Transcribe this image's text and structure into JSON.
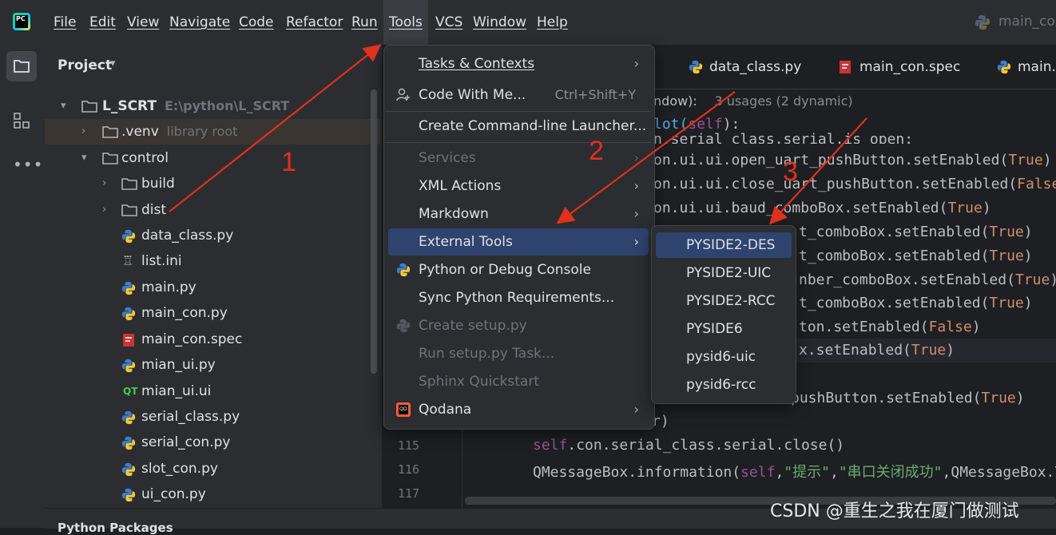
{
  "app": {
    "logo_text": "PC"
  },
  "menubar": {
    "items": [
      {
        "id": "file",
        "label": "File"
      },
      {
        "id": "edit",
        "label": "Edit"
      },
      {
        "id": "view",
        "label": "View"
      },
      {
        "id": "navigate",
        "label": "Navigate"
      },
      {
        "id": "code",
        "label": "Code"
      },
      {
        "id": "refactor",
        "label": "Refactor"
      },
      {
        "id": "run",
        "label": "Run"
      },
      {
        "id": "tools",
        "label": "Tools"
      },
      {
        "id": "vcs",
        "label": "VCS"
      },
      {
        "id": "window",
        "label": "Window"
      },
      {
        "id": "help",
        "label": "Help"
      }
    ],
    "right_label": "main_con"
  },
  "project": {
    "title": "Project",
    "tree": [
      {
        "name": "L_SCRT",
        "hint": "E:\\python\\L_SCRT",
        "type": "folder",
        "expanded": true
      },
      {
        "name": ".venv",
        "hint": "library root",
        "type": "folder",
        "expanded": false
      },
      {
        "name": "control",
        "hint": "",
        "type": "folder",
        "expanded": true
      },
      {
        "name": "build",
        "hint": "",
        "type": "folder",
        "expanded": false
      },
      {
        "name": "dist",
        "hint": "",
        "type": "folder",
        "expanded": false
      },
      {
        "name": "data_class.py",
        "hint": "",
        "type": "python"
      },
      {
        "name": "list.ini",
        "hint": "",
        "type": "ini"
      },
      {
        "name": "main.py",
        "hint": "",
        "type": "python"
      },
      {
        "name": "main_con.py",
        "hint": "",
        "type": "python"
      },
      {
        "name": "main_con.spec",
        "hint": "",
        "type": "spec"
      },
      {
        "name": "mian_ui.py",
        "hint": "",
        "type": "python"
      },
      {
        "name": "mian_ui.ui",
        "hint": "",
        "type": "qt"
      },
      {
        "name": "serial_class.py",
        "hint": "",
        "type": "python"
      },
      {
        "name": "serial_con.py",
        "hint": "",
        "type": "python"
      },
      {
        "name": "slot_con.py",
        "hint": "",
        "type": "python"
      },
      {
        "name": "ui_con.py",
        "hint": "",
        "type": "python"
      }
    ],
    "bottom_panel": "Python Packages"
  },
  "editor": {
    "tabs": [
      {
        "label": "data_class.py"
      },
      {
        "label": "main_con.spec"
      },
      {
        "label": "main.py"
      }
    ],
    "usage_hint_prefix": "ndow):",
    "usage_hint": "3 usages (2 dynamic)",
    "lines": {
      "l1a": "lot(",
      "l1b": "self",
      "l1c": "):",
      "l2": "n.serial_class.serial.is_open:",
      "l3a": "on.ui.ui.open_uart_pushButton.setEnabled(",
      "l3b": "True",
      "l3c": ")",
      "l4a": "on.ui.ui.close_uart_pushButton.setEnabled(",
      "l4b": "False",
      "l5a": "on.ui.ui.baud_comboBox.setEnabled(",
      "l5b": "True",
      "l5c": ")",
      "l6a": "t_comboBox.setEnabled(",
      "l6b": "True",
      "l6c": ")",
      "l7a": "t_comboBox.setEnabled(",
      "l7b": "True",
      "l7c": ")",
      "l8a": "nber_comboBox.setEnabled(",
      "l8b": "True",
      "l8c": ")",
      "l9a": "t_comboBox.setEnabled(",
      "l9b": "True",
      "l9c": ")",
      "l10a": "ton.setEnabled(",
      "l10b": "False",
      "l10c": ")",
      "l11a": "x.setEnabled(",
      "l11b": "True",
      "l11c": ")",
      "l12a": "pushButton.setEnabled(",
      "l12b": "True",
      "l12c": ")",
      "l13": "r)",
      "l14a": "self",
      "l14b": ".con.serial_class.serial.close()",
      "l15a": "QMessageBox.information(",
      "l15b": "self",
      "l15c": ",",
      "l15d": "\"提示\"",
      "l15e": ",",
      "l15f": "\"串口关闭成功\"",
      "l15g": ",QMessageBox.Y"
    },
    "line_numbers": [
      "115",
      "116",
      "117"
    ]
  },
  "tools_menu": {
    "items": [
      {
        "label": "Tasks & Contexts",
        "submenu": true,
        "disabled": false
      },
      {
        "label": "Code With Me...",
        "shortcut": "Ctrl+Shift+Y",
        "disabled": false
      },
      {
        "label": "Create Command-line Launcher...",
        "disabled": false
      },
      {
        "label": "Services",
        "submenu": true,
        "disabled": true
      },
      {
        "label": "XML Actions",
        "submenu": true,
        "disabled": false
      },
      {
        "label": "Markdown",
        "submenu": true,
        "disabled": false
      },
      {
        "label": "External Tools",
        "submenu": true,
        "disabled": false,
        "highlighted": true
      },
      {
        "label": "Python or Debug Console",
        "disabled": false
      },
      {
        "label": "Sync Python Requirements...",
        "disabled": false
      },
      {
        "label": "Create setup.py",
        "disabled": true
      },
      {
        "label": "Run setup.py Task...",
        "disabled": true
      },
      {
        "label": "Sphinx Quickstart",
        "disabled": true
      },
      {
        "label": "Qodana",
        "submenu": true,
        "disabled": false
      }
    ]
  },
  "external_tools_menu": {
    "items": [
      {
        "label": "PYSIDE2-DES",
        "highlighted": true
      },
      {
        "label": "PYSIDE2-UIC"
      },
      {
        "label": "PYSIDE2-RCC"
      },
      {
        "label": "PYSIDE6"
      },
      {
        "label": "pysid6-uic"
      },
      {
        "label": "pysid6-rcc"
      }
    ]
  },
  "annotations": {
    "n1": "1",
    "n2": "2",
    "n3": "3",
    "color": "#e0301e"
  },
  "watermark": "CSDN @重生之我在厦门做测试"
}
